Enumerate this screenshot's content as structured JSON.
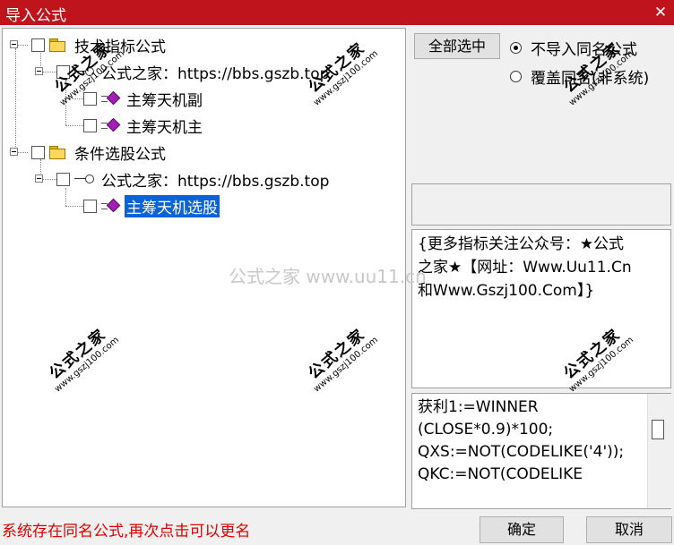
{
  "window": {
    "title": "导入公式",
    "close_icon": "close-icon"
  },
  "tree": {
    "n1": "技术指标公式",
    "n1a": "公式之家：https://bbs.gszb.top",
    "n1a1": "主筹天机副",
    "n1a2": "主筹天机主",
    "n2": "条件选股公式",
    "n2a": "公式之家：https://bbs.gszb.top",
    "n2a1": "主筹天机选股"
  },
  "controls": {
    "select_all_label": "全部选中",
    "radio_skip": "不导入同名公式",
    "radio_overwrite": "覆盖同名(非系统)"
  },
  "info_lines": [
    "{更多指标关注公众号：★公式",
    "之家★【网址：Www.Uu11.Cn",
    "和Www.Gszj100.Com】}"
  ],
  "code_lines": [
    "获利1:=WINNER",
    "(CLOSE*0.9)*100;",
    "QXS:=NOT(CODELIKE('4'));",
    "QKC:=NOT(CODELIKE"
  ],
  "status_text": "系统存在同名公式,再次点击可以更名",
  "buttons": {
    "ok": "确定",
    "cancel": "取消"
  },
  "watermarks": {
    "center": "公式之家 www.uu11.cn",
    "stamp_cn": "公式之家",
    "stamp_url": "www.gszj100.com"
  }
}
